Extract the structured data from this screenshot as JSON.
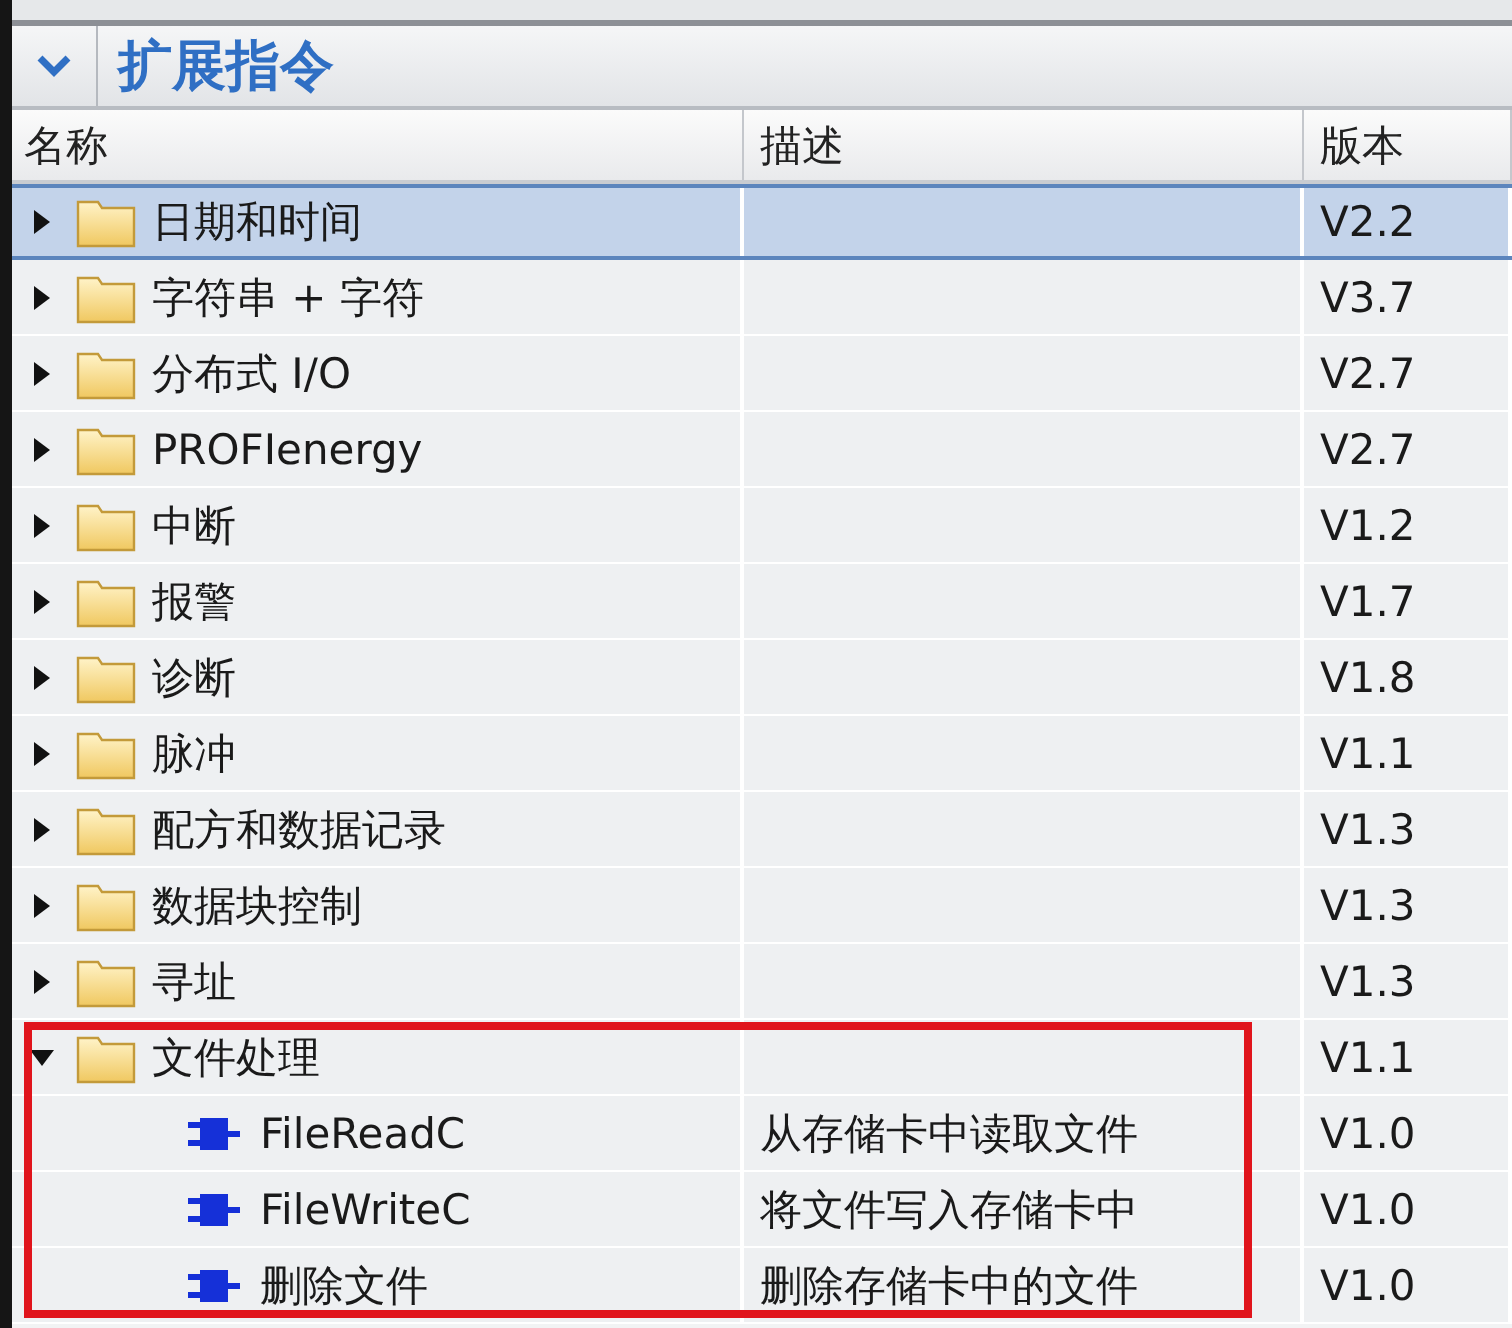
{
  "section": {
    "title": "扩展指令",
    "expanded": true
  },
  "columns": [
    {
      "label": "名称"
    },
    {
      "label": "描述"
    },
    {
      "label": "版本"
    }
  ],
  "rows": [
    {
      "kind": "folder",
      "name": "日期和时间",
      "description": "",
      "version": "V2.2",
      "expanded": false,
      "selected": true
    },
    {
      "kind": "folder",
      "name": "字符串 + 字符",
      "description": "",
      "version": "V3.7",
      "expanded": false,
      "selected": false
    },
    {
      "kind": "folder",
      "name": "分布式 I/O",
      "description": "",
      "version": "V2.7",
      "expanded": false,
      "selected": false
    },
    {
      "kind": "folder",
      "name": "PROFIenergy",
      "description": "",
      "version": "V2.7",
      "expanded": false,
      "selected": false
    },
    {
      "kind": "folder",
      "name": "中断",
      "description": "",
      "version": "V1.2",
      "expanded": false,
      "selected": false
    },
    {
      "kind": "folder",
      "name": "报警",
      "description": "",
      "version": "V1.7",
      "expanded": false,
      "selected": false
    },
    {
      "kind": "folder",
      "name": "诊断",
      "description": "",
      "version": "V1.8",
      "expanded": false,
      "selected": false
    },
    {
      "kind": "folder",
      "name": "脉冲",
      "description": "",
      "version": "V1.1",
      "expanded": false,
      "selected": false
    },
    {
      "kind": "folder",
      "name": "配方和数据记录",
      "description": "",
      "version": "V1.3",
      "expanded": false,
      "selected": false
    },
    {
      "kind": "folder",
      "name": "数据块控制",
      "description": "",
      "version": "V1.3",
      "expanded": false,
      "selected": false
    },
    {
      "kind": "folder",
      "name": "寻址",
      "description": "",
      "version": "V1.3",
      "expanded": false,
      "selected": false
    },
    {
      "kind": "folder",
      "name": "文件处理",
      "description": "",
      "version": "V1.1",
      "expanded": true,
      "selected": false,
      "highlighted": true,
      "children": [
        {
          "kind": "block",
          "name": "FileReadC",
          "description": "从存储卡中读取文件",
          "version": "V1.0",
          "selected": false
        },
        {
          "kind": "block",
          "name": "FileWriteC",
          "description": "将文件写入存储卡中",
          "version": "V1.0",
          "selected": false
        },
        {
          "kind": "block",
          "name": "删除文件",
          "description": "删除存储卡中的文件",
          "version": "V1.0",
          "selected": false
        }
      ]
    }
  ]
}
